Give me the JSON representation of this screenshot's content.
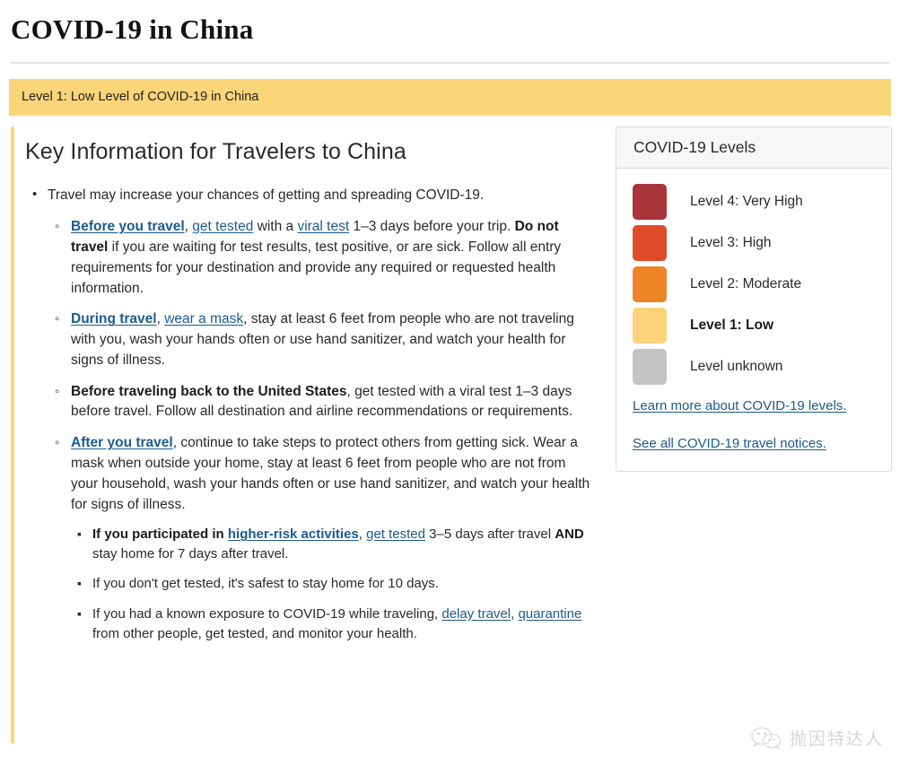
{
  "page": {
    "title": "COVID-19 in China"
  },
  "alert": {
    "text": "Level 1: Low Level of COVID-19 in China",
    "background_color": "#FBD579"
  },
  "main": {
    "heading": "Key Information for Travelers to China",
    "bullets": [
      {
        "text": "Travel may increase your chances of getting and spreading COVID-19.",
        "sub": [
          {
            "segments": [
              {
                "text": "Before you travel",
                "style": "link-bold"
              },
              {
                "text": ", ",
                "style": "plain"
              },
              {
                "text": "get tested",
                "style": "link"
              },
              {
                "text": " with a ",
                "style": "plain"
              },
              {
                "text": "viral test",
                "style": "link"
              },
              {
                "text": " 1–3 days before your trip. ",
                "style": "plain"
              },
              {
                "text": "Do not travel",
                "style": "bold"
              },
              {
                "text": " if you are waiting for test results, test positive, or are sick. Follow all entry requirements for your destination and provide any required or requested health information.",
                "style": "plain"
              }
            ]
          },
          {
            "segments": [
              {
                "text": "During travel",
                "style": "link-bold"
              },
              {
                "text": ", ",
                "style": "plain"
              },
              {
                "text": "wear a mask",
                "style": "link"
              },
              {
                "text": ", stay at least 6 feet from people who are not traveling with you, wash your hands often or use hand sanitizer, and watch your health for signs of illness.",
                "style": "plain"
              }
            ]
          },
          {
            "segments": [
              {
                "text": "Before traveling back to the United States",
                "style": "bold"
              },
              {
                "text": ", get tested with a viral test 1–3 days before travel. Follow all destination and airline recommendations or requirements.",
                "style": "plain"
              }
            ]
          },
          {
            "segments": [
              {
                "text": "After you travel",
                "style": "link-bold"
              },
              {
                "text": ", continue to take steps to protect others from getting sick. Wear a mask when outside your home, stay at least 6 feet from people who are not from your household, wash your hands often or use hand sanitizer, and watch your health for signs of illness.",
                "style": "plain"
              }
            ],
            "sub": [
              {
                "segments": [
                  {
                    "text": "If you participated in ",
                    "style": "bold"
                  },
                  {
                    "text": "higher-risk activities",
                    "style": "link-bold"
                  },
                  {
                    "text": ", ",
                    "style": "plain"
                  },
                  {
                    "text": "get tested",
                    "style": "link"
                  },
                  {
                    "text": " 3–5 days after travel ",
                    "style": "plain"
                  },
                  {
                    "text": "AND",
                    "style": "bold"
                  },
                  {
                    "text": " stay home for 7 days after travel.",
                    "style": "plain"
                  }
                ]
              },
              {
                "segments": [
                  {
                    "text": "If you don't get tested, it's safest to stay home for 10 days.",
                    "style": "plain"
                  }
                ]
              },
              {
                "segments": [
                  {
                    "text": "If you had a known exposure to COVID-19 while traveling, ",
                    "style": "plain"
                  },
                  {
                    "text": "delay travel",
                    "style": "link"
                  },
                  {
                    "text": ", ",
                    "style": "plain"
                  },
                  {
                    "text": "quarantine",
                    "style": "link"
                  },
                  {
                    "text": " from other people, get tested, and monitor your health.",
                    "style": "plain"
                  }
                ]
              }
            ]
          }
        ]
      }
    ]
  },
  "sidebar": {
    "card_title": "COVID-19 Levels",
    "levels": [
      {
        "label": "Level 4: Very High",
        "color": "#A93439",
        "current": false
      },
      {
        "label": "Level 3: High",
        "color": "#E04B28",
        "current": false
      },
      {
        "label": "Level 2: Moderate",
        "color": "#ED8527",
        "current": false
      },
      {
        "label": "Level 1: Low",
        "color": "#FCD27B",
        "current": true
      },
      {
        "label": "Level unknown",
        "color": "#C4C4C4",
        "current": false
      }
    ],
    "links": [
      "Learn more about COVID-19 levels.",
      "See all COVID-19 travel notices."
    ]
  },
  "watermark": {
    "icon": "wechat-icon",
    "text": "抛因特达人"
  }
}
